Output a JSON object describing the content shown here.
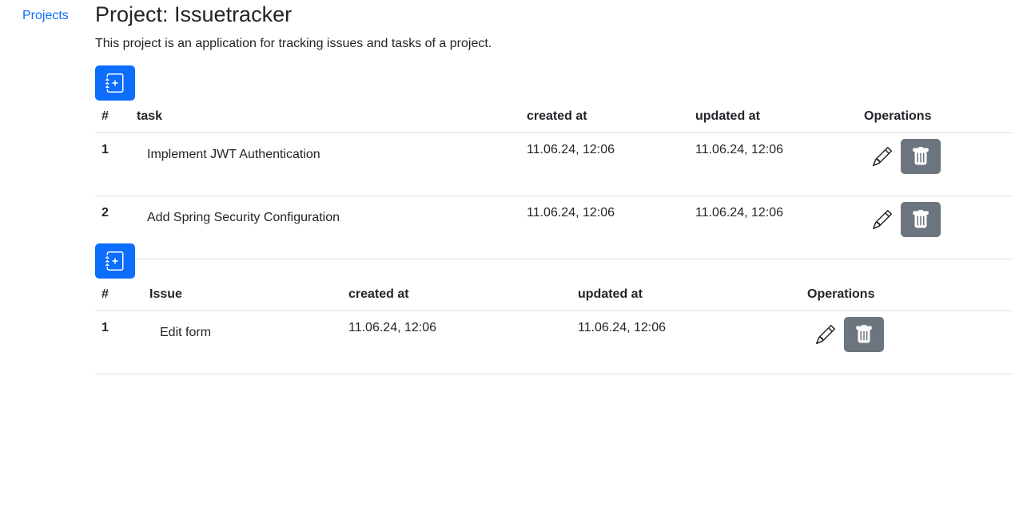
{
  "nav": {
    "projects_link": "Projects"
  },
  "page": {
    "title": "Project: Issuetracker",
    "description": "This project is an application for tracking issues and tasks of a project."
  },
  "icons": {
    "add": "journal-plus-icon",
    "edit": "pencil-icon",
    "delete": "trash-icon"
  },
  "colors": {
    "primary": "#0d6efd",
    "secondary": "#6c757d",
    "link": "#0d6efd",
    "text": "#212529"
  },
  "tasks_table": {
    "headers": {
      "num": "#",
      "name": "task",
      "created": "created at",
      "updated": "updated at",
      "ops": "Operations"
    },
    "rows": [
      {
        "num": "1",
        "name": "Implement JWT Authentication",
        "created": "11.06.24, 12:06",
        "updated": "11.06.24, 12:06"
      },
      {
        "num": "2",
        "name": "Add Spring Security Configuration",
        "created": "11.06.24, 12:06",
        "updated": "11.06.24, 12:06"
      }
    ]
  },
  "issues_table": {
    "headers": {
      "num": "#",
      "name": "Issue",
      "created": "created at",
      "updated": "updated at",
      "ops": "Operations"
    },
    "rows": [
      {
        "num": "1",
        "name": "Edit form",
        "created": "11.06.24, 12:06",
        "updated": "11.06.24, 12:06"
      }
    ]
  }
}
